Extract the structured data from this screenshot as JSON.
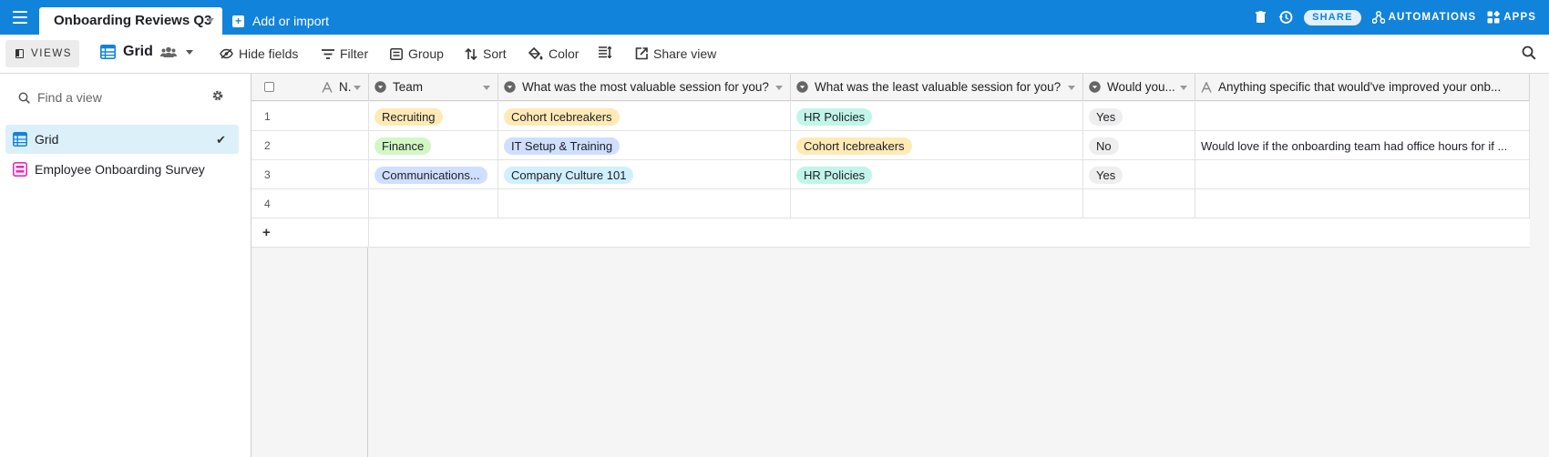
{
  "app": {
    "base_title": "Onboarding Reviews Q3",
    "add_import_label": "Add or import",
    "share_label": "SHARE",
    "automations_label": "AUTOMATIONS",
    "apps_label": "APPS",
    "brand_color": "#1283da"
  },
  "toolbar": {
    "views_label": "VIEWS",
    "view_name": "Grid",
    "hide_fields": "Hide fields",
    "filter": "Filter",
    "group": "Group",
    "sort": "Sort",
    "color": "Color",
    "share_view": "Share view"
  },
  "sidebar": {
    "find_placeholder": "Find a view",
    "views": [
      {
        "label": "Grid",
        "icon": "grid-icon",
        "active": true
      },
      {
        "label": "Employee Onboarding Survey",
        "icon": "form-icon",
        "active": false
      }
    ]
  },
  "grid": {
    "primary_header": "N.",
    "columns": [
      {
        "label": "Team",
        "icon": "single-select-icon"
      },
      {
        "label": "What was the most valuable session for you?",
        "icon": "single-select-icon"
      },
      {
        "label": "What was the least valuable session for you?",
        "icon": "single-select-icon"
      },
      {
        "label": "Would you...",
        "icon": "single-select-icon"
      },
      {
        "label": "Anything specific that would've improved your onb...",
        "icon": "text-icon"
      }
    ],
    "rows": [
      {
        "num": "1",
        "team": "Recruiting",
        "most": "Cohort Icebreakers",
        "least": "HR Policies",
        "would": "Yes",
        "anything": ""
      },
      {
        "num": "2",
        "team": "Finance",
        "most": "IT Setup & Training",
        "least": "Cohort Icebreakers",
        "would": "No",
        "anything": "Would love if the onboarding team had office hours for if ..."
      },
      {
        "num": "3",
        "team": "Communications...",
        "most": "Company Culture 101",
        "least": "HR Policies",
        "would": "Yes",
        "anything": ""
      },
      {
        "num": "4",
        "team": "",
        "most": "",
        "least": "",
        "would": "",
        "anything": ""
      }
    ],
    "add_row_label": "+",
    "pill_colors": {
      "Recruiting": "#ffeab6",
      "Finance": "#d1f7c4",
      "Communications...": "#cfdfff",
      "Cohort Icebreakers": "#ffeab6",
      "IT Setup & Training": "#cfdfff",
      "Company Culture 101": "#d0f0fd",
      "HR Policies": "#c2f5e9",
      "Yes": "#eeeeee",
      "No": "#eeeeee"
    }
  }
}
